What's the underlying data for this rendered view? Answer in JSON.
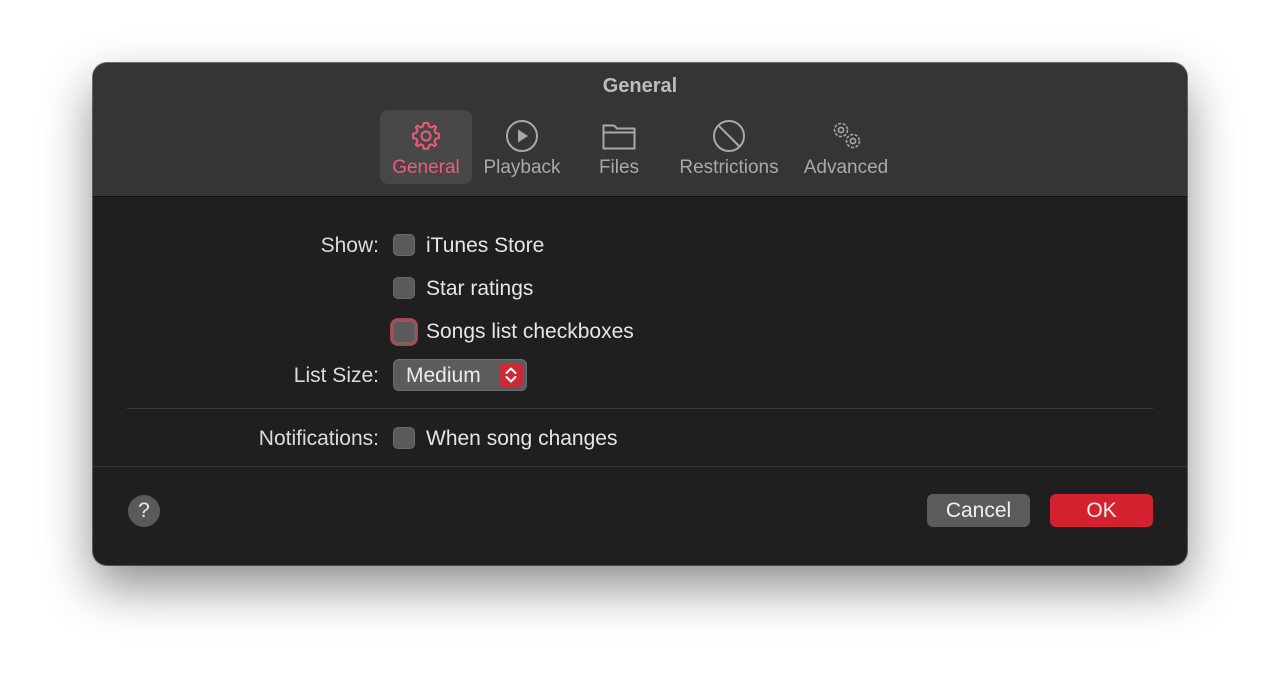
{
  "window": {
    "title": "General"
  },
  "tabs": [
    {
      "label": "General",
      "icon": "gear-icon",
      "active": true
    },
    {
      "label": "Playback",
      "icon": "play-circle-icon",
      "active": false
    },
    {
      "label": "Files",
      "icon": "folder-icon",
      "active": false
    },
    {
      "label": "Restrictions",
      "icon": "prohibited-icon",
      "active": false
    },
    {
      "label": "Advanced",
      "icon": "gears-icon",
      "active": false
    }
  ],
  "show": {
    "label": "Show:",
    "options": [
      {
        "label": "iTunes Store",
        "checked": false
      },
      {
        "label": "Star ratings",
        "checked": false
      },
      {
        "label": "Songs list checkboxes",
        "checked": false,
        "focused": true
      }
    ]
  },
  "list_size": {
    "label": "List Size:",
    "value": "Medium"
  },
  "notifications": {
    "label": "Notifications:",
    "option_label": "When song changes",
    "checked": false
  },
  "footer": {
    "help_label": "?",
    "cancel_label": "Cancel",
    "ok_label": "OK"
  },
  "colors": {
    "accent_pink": "#ef5a7d",
    "ok_red": "#d3212f",
    "window_bg": "#1f1f1f",
    "titlebar_bg": "#353535"
  }
}
